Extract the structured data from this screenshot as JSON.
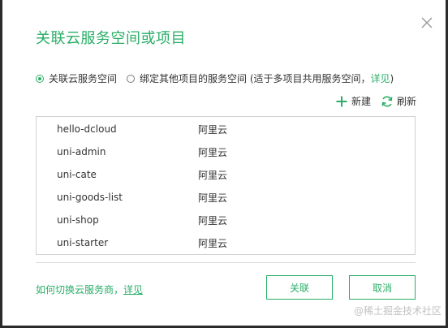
{
  "dialog": {
    "title": "关联云服务空间或项目",
    "options": {
      "link_space_label": "关联云服务空间",
      "bind_project_label": "绑定其他项目的服务空间 (适于多项目共用服务空间，",
      "bind_project_link": "详见",
      "bind_project_suffix": ")",
      "selected": "link_space"
    },
    "toolbar": {
      "new_label": "新建",
      "refresh_label": "刷新"
    },
    "spaces": [
      {
        "name": "hello-dcloud",
        "provider": "阿里云"
      },
      {
        "name": "uni-admin",
        "provider": "阿里云"
      },
      {
        "name": "uni-cate",
        "provider": "阿里云"
      },
      {
        "name": "uni-goods-list",
        "provider": "阿里云"
      },
      {
        "name": "uni-shop",
        "provider": "阿里云"
      },
      {
        "name": "uni-starter",
        "provider": "阿里云"
      }
    ],
    "help": {
      "text": "如何切换云服务商，",
      "link": "详见"
    },
    "buttons": {
      "confirm": "关联",
      "cancel": "取消"
    }
  },
  "watermark": "@稀土掘金技术社区",
  "colors": {
    "accent": "#2aae67",
    "text": "#333333",
    "border": "#d2d2d2"
  },
  "icons": {
    "close": "close-icon",
    "add": "plus-icon",
    "refresh": "refresh-icon"
  }
}
